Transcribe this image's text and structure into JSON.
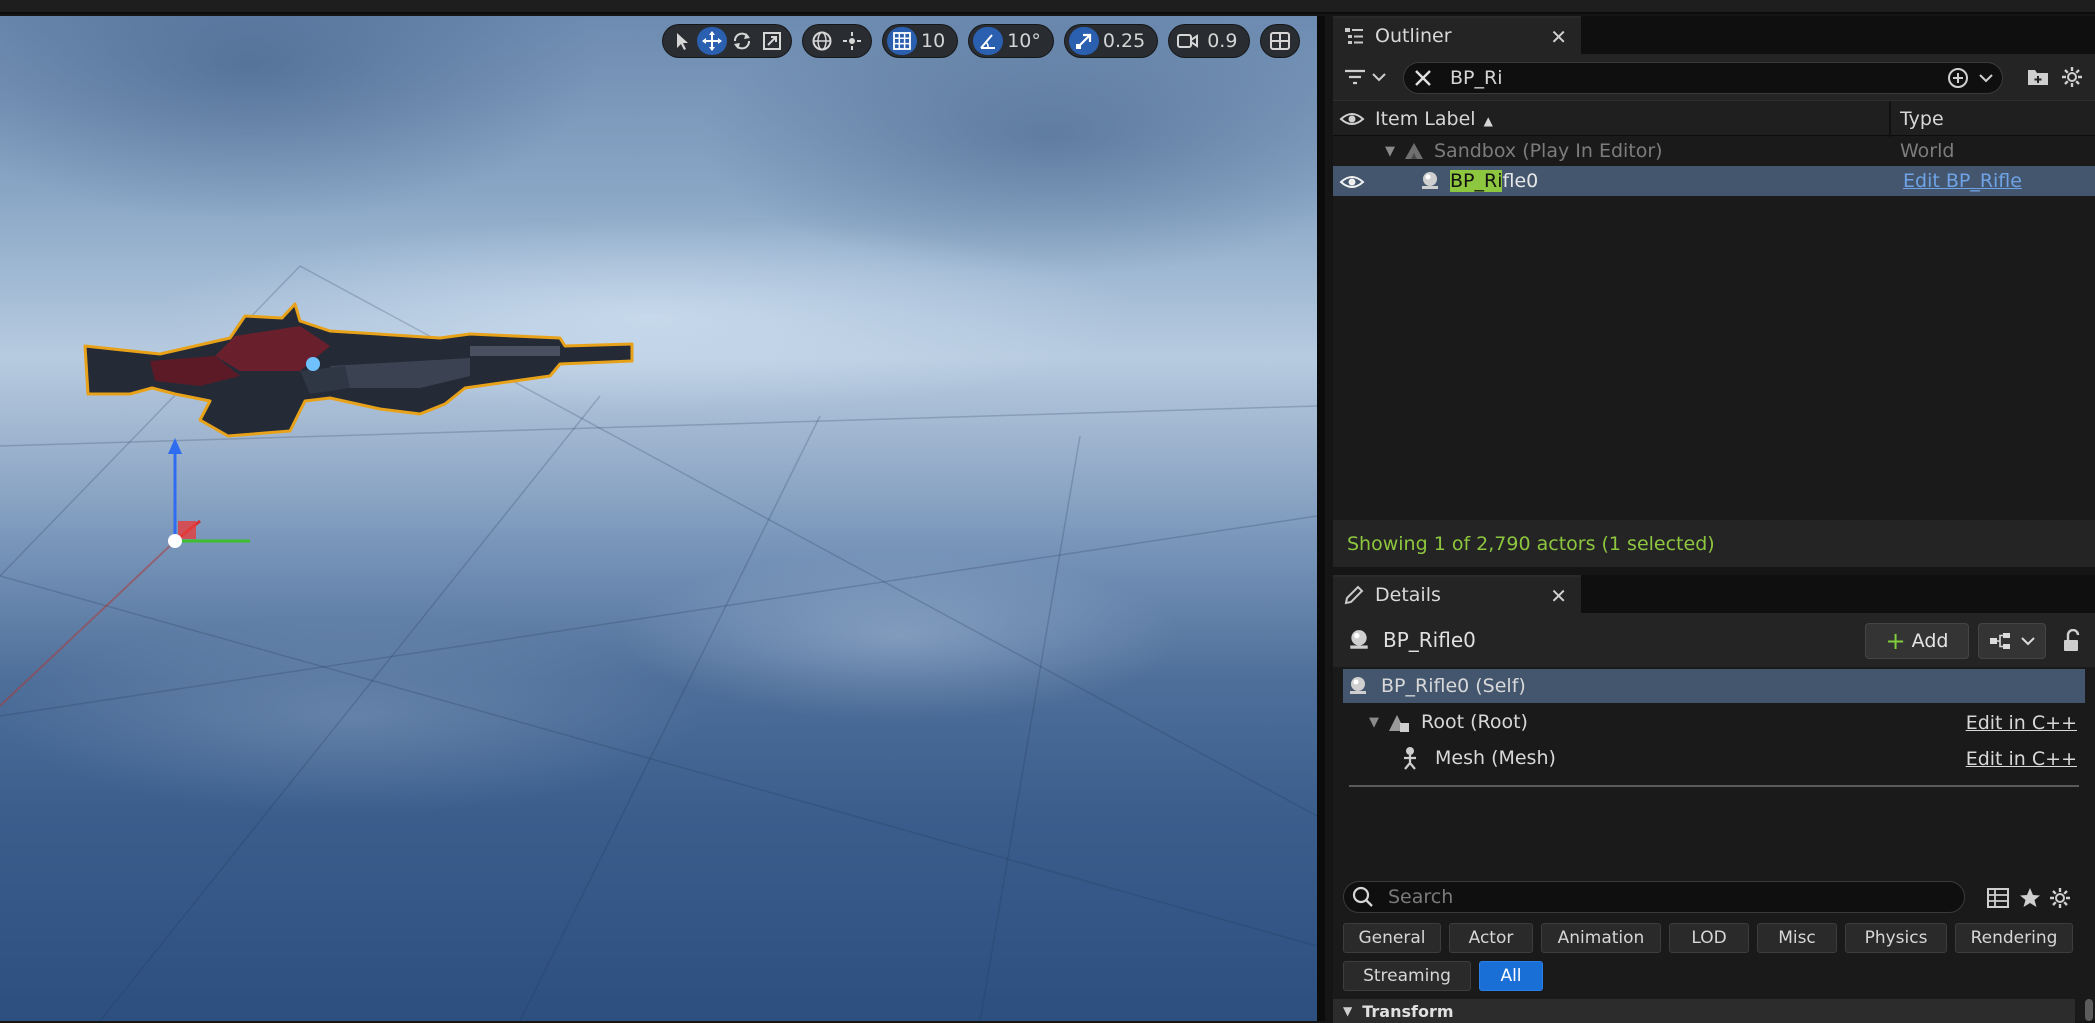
{
  "viewport": {
    "toolbar": {
      "grid_snap_value": "10",
      "rotation_snap_value": "10°",
      "scale_snap_value": "0.25",
      "camera_speed_value": "0.9"
    }
  },
  "outliner": {
    "tab_title": "Outliner",
    "search_value": "BP_Ri",
    "columns": {
      "label": "Item Label",
      "type": "Type"
    },
    "rows": [
      {
        "label": "Sandbox (Play In Editor)",
        "type": "World"
      },
      {
        "label_highlight": "BP_Ri",
        "label_rest": "fle0",
        "type": "Edit BP_Rifle"
      }
    ],
    "status": "Showing 1 of 2,790 actors (1 selected)"
  },
  "details": {
    "tab_title": "Details",
    "actor_name": "BP_Rifle0",
    "add_label": "Add",
    "components": [
      {
        "label": "BP_Rifle0 (Self)",
        "action": ""
      },
      {
        "label": "Root (Root)",
        "action": "Edit in C++"
      },
      {
        "label": "Mesh (Mesh)",
        "action": "Edit in C++"
      }
    ],
    "search_placeholder": "Search",
    "filters": [
      "General",
      "Actor",
      "Animation",
      "LOD",
      "Misc",
      "Physics",
      "Rendering",
      "Streaming",
      "All"
    ],
    "active_filter": "All",
    "section": "Transform"
  },
  "colors": {
    "selection": "#43566e",
    "search_highlight": "#8dc63f",
    "status_text": "#8dc63f",
    "link": "#6fa3e6",
    "active_toggle": "#2b5fb0",
    "active_filter": "#1a6fd6"
  }
}
